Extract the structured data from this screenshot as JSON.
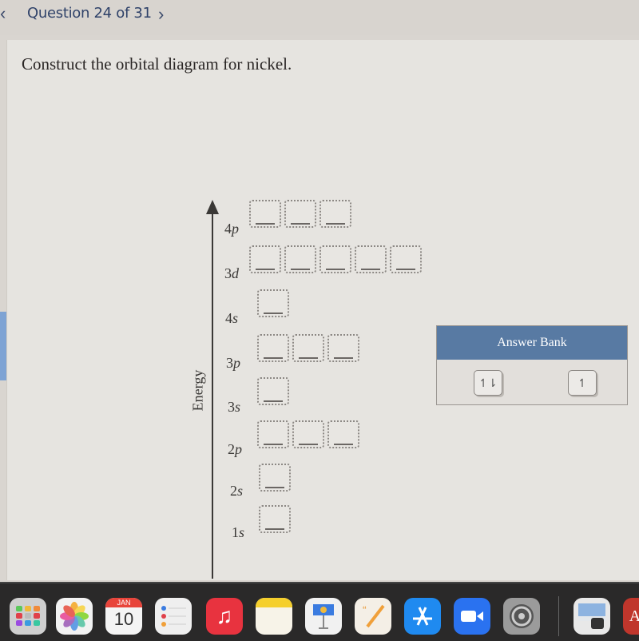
{
  "header": {
    "prev_icon": "chevron-left",
    "title": "Question 24 of 31",
    "next_icon": "chevron-right"
  },
  "question": {
    "prompt": "Construct the orbital diagram for nickel."
  },
  "diagram": {
    "axis_label": "Energy",
    "orbitals": [
      {
        "n": "4",
        "l": "p",
        "boxes": 3
      },
      {
        "n": "3",
        "l": "d",
        "boxes": 5
      },
      {
        "n": "4",
        "l": "s",
        "boxes": 1
      },
      {
        "n": "3",
        "l": "p",
        "boxes": 3
      },
      {
        "n": "3",
        "l": "s",
        "boxes": 1
      },
      {
        "n": "2",
        "l": "p",
        "boxes": 3
      },
      {
        "n": "2",
        "l": "s",
        "boxes": 1
      },
      {
        "n": "1",
        "l": "s",
        "boxes": 1
      }
    ]
  },
  "answer_bank": {
    "title": "Answer Bank",
    "tiles": [
      {
        "label": "↿⇂",
        "meaning": "paired electrons"
      },
      {
        "label": "↿",
        "meaning": "single electron"
      }
    ]
  },
  "dock": {
    "calendar_month": "JAN",
    "calendar_day": "10",
    "apps": [
      "launchpad",
      "photos",
      "calendar",
      "reminders",
      "music",
      "notes",
      "keynote",
      "pages",
      "app-store",
      "zoom",
      "system-preferences",
      "preview",
      "acrobat"
    ]
  },
  "colors": {
    "header_blue": "#587aa3",
    "title_blue": "#2f4269"
  }
}
